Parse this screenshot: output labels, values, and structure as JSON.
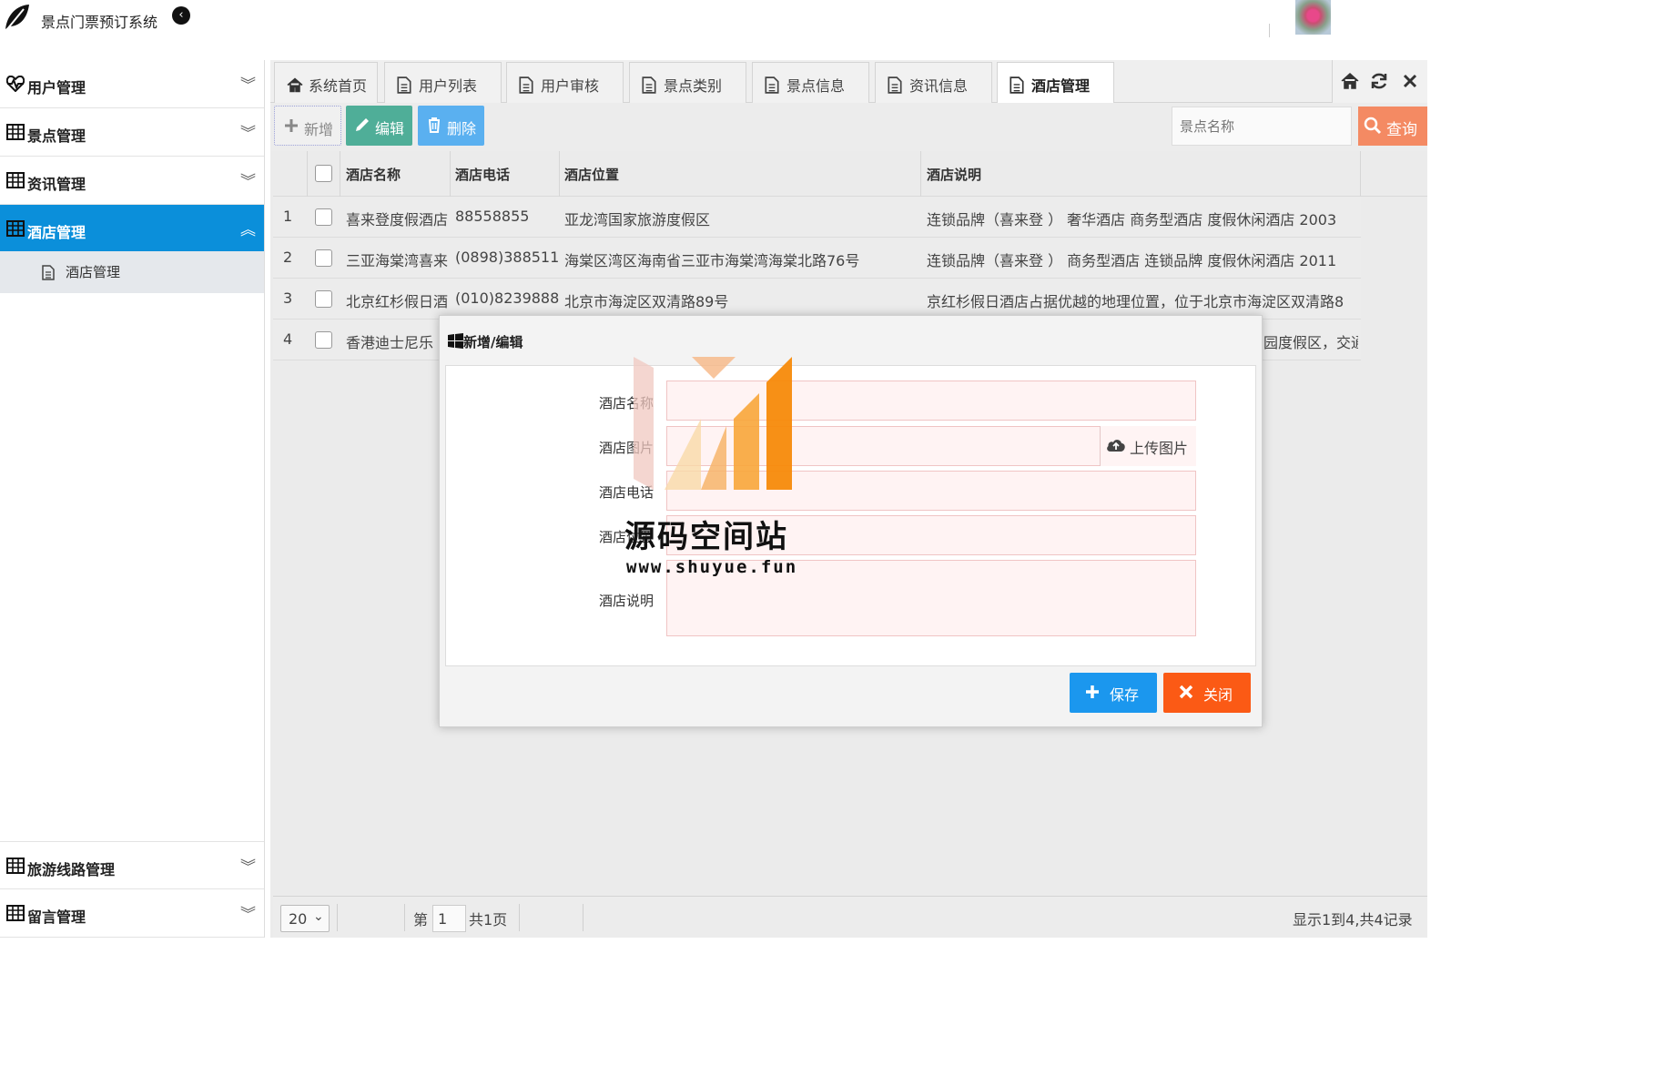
{
  "app": {
    "title": "景点门票预订系统"
  },
  "sidebar": {
    "items": [
      {
        "label": "用户管理",
        "icon": "heartbeat-icon"
      },
      {
        "label": "景点管理",
        "icon": "table-icon"
      },
      {
        "label": "资讯管理",
        "icon": "table-icon"
      },
      {
        "label": "酒店管理",
        "icon": "table-icon",
        "active": true
      },
      {
        "label": "旅游线路管理",
        "icon": "table-icon"
      },
      {
        "label": "留言管理",
        "icon": "table-icon"
      }
    ],
    "submenu": {
      "label": "酒店管理"
    }
  },
  "tabs": [
    {
      "label": "系统首页",
      "icon": "home-icon"
    },
    {
      "label": "用户列表",
      "icon": "file-icon"
    },
    {
      "label": "用户审核",
      "icon": "file-icon"
    },
    {
      "label": "景点类别",
      "icon": "file-icon"
    },
    {
      "label": "景点信息",
      "icon": "file-icon"
    },
    {
      "label": "资讯信息",
      "icon": "file-icon"
    },
    {
      "label": "酒店管理",
      "icon": "file-icon",
      "active": true
    }
  ],
  "toolbar": {
    "add_label": "新增",
    "edit_label": "编辑",
    "delete_label": "删除",
    "search_placeholder": "景点名称",
    "search_label": "查询"
  },
  "table": {
    "columns": [
      "酒店名称",
      "酒店电话",
      "酒店位置",
      "酒店说明"
    ],
    "rows": [
      {
        "no": "1",
        "name": "喜来登度假酒店",
        "phone": "88558855",
        "location": "亚龙湾国家旅游度假区",
        "desc": "连锁品牌（喜来登 ） 奢华酒店 商务型酒店 度假休闲酒店 2003"
      },
      {
        "no": "2",
        "name": "三亚海棠湾喜来",
        "phone": "(0898)388511",
        "location": "海棠区湾区海南省三亚市海棠湾海棠北路76号",
        "desc": "连锁品牌（喜来登 ） 商务型酒店 连锁品牌 度假休闲酒店 2011"
      },
      {
        "no": "3",
        "name": "北京红杉假日酒",
        "phone": "(010)8239888",
        "location": "北京市海淀区双清路89号",
        "desc": "京红杉假日酒店占据优越的地理位置，位于北京市海淀区双清路8"
      },
      {
        "no": "4",
        "name": "香港迪士尼乐",
        "phone": "",
        "location": "",
        "desc": "园度假区，交通"
      }
    ]
  },
  "modal": {
    "title": "新增/编辑",
    "fields": [
      {
        "label": "酒店名称"
      },
      {
        "label": "酒店图片"
      },
      {
        "label": "酒店电话"
      },
      {
        "label": "酒店位置"
      },
      {
        "label": "酒店说明"
      }
    ],
    "upload_label": "上传图片",
    "save_label": "保存",
    "close_label": "关闭"
  },
  "watermark": {
    "text": "源码空间站",
    "url": "www.shuyue.fun"
  },
  "pager": {
    "page_size": "20",
    "page_prefix": "第",
    "page_value": "1",
    "page_suffix": "共1页",
    "info": "显示1到4,共4记录"
  },
  "colors": {
    "accent": "#0b8fda",
    "edit": "#4fae98",
    "delete": "#5ab0f0",
    "search": "#f48a63",
    "save": "#1b97ee",
    "close": "#fb5a15"
  }
}
